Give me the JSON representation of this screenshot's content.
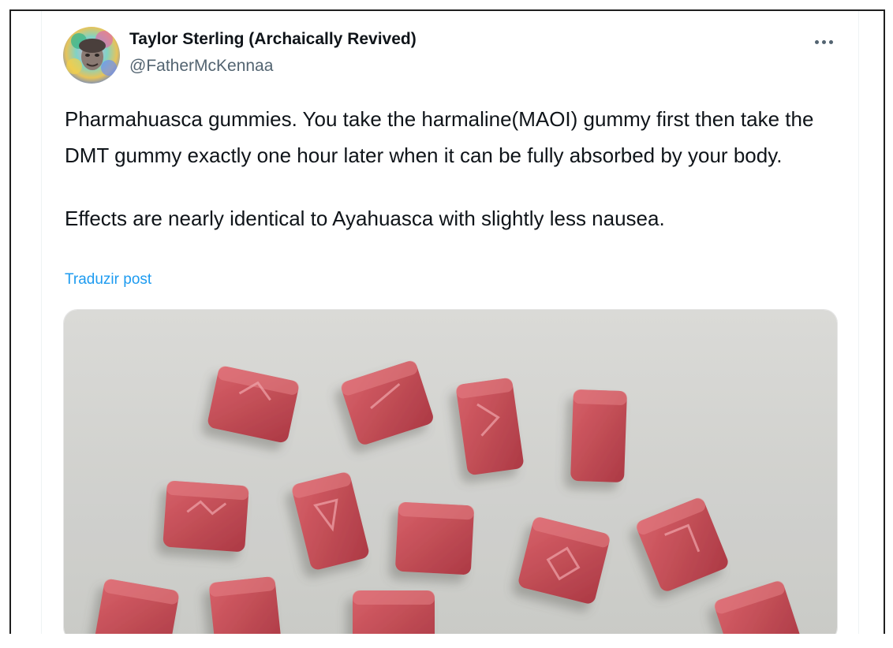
{
  "author": {
    "name": "Taylor Sterling (Archaically Revived)",
    "handle": "@FatherMcKennaa",
    "avatar_icon": "avatar-portrait-icon"
  },
  "post": {
    "paragraphs": [
      "Pharmahuasca gummies. You take the harmaline(MAOI) gummy first then take the DMT gummy exactly one hour later when it can be fully absorbed by your body.",
      "Effects are nearly identical to Ayahuasca with slightly less nausea."
    ],
    "translate_label": "Traduzir post"
  },
  "menu": {
    "icon": "more-dots-icon"
  },
  "media": {
    "subject": "red sugar-coated gummy cubes on a white surface"
  },
  "colors": {
    "link": "#1d9bf0",
    "text": "#0f1419",
    "secondary": "#536471",
    "gummy": "#c0444f"
  }
}
